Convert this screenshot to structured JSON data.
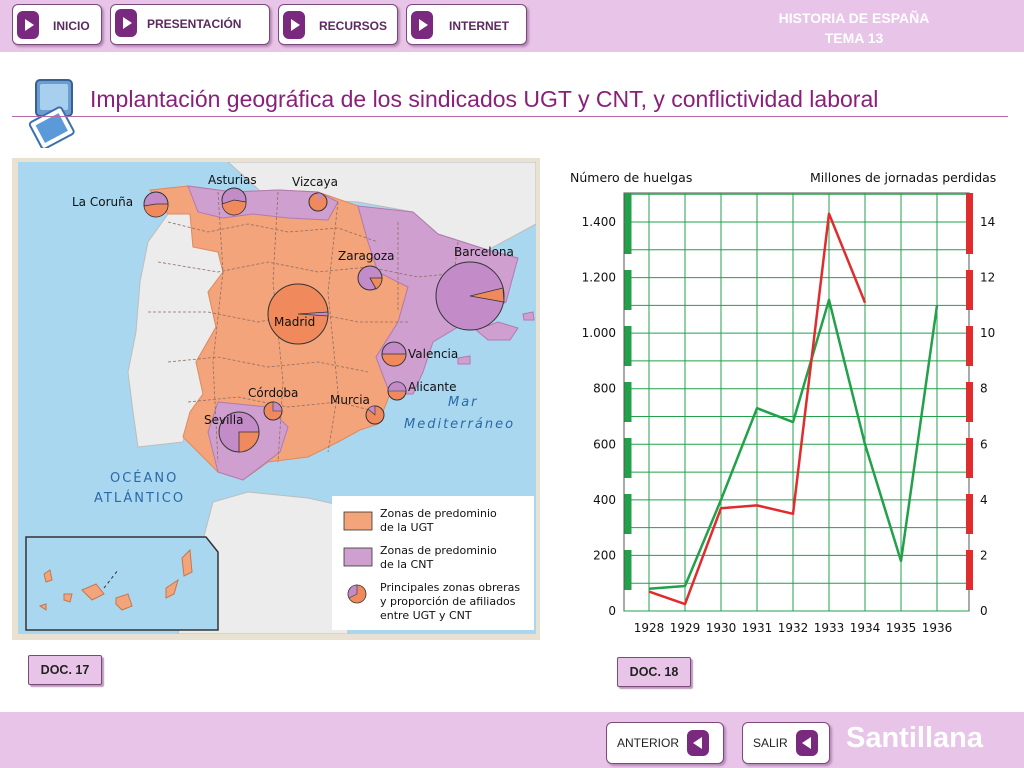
{
  "nav": {
    "items": [
      {
        "label": "INICIO"
      },
      {
        "label": "PRESENTACIÓN"
      },
      {
        "label": "RECURSOS"
      },
      {
        "label": "INTERNET"
      }
    ],
    "corner_line1": "HISTORIA DE ESPAÑA",
    "corner_line2": "TEMA 13"
  },
  "title": "Implantación geográfica de los sindicados UGT y CNT, y conflictividad laboral",
  "map": {
    "place_labels": [
      "La Coruña",
      "Asturias",
      "Vizcaya",
      "Zaragoza",
      "Barcelona",
      "Madrid",
      "Valencia",
      "Alicante",
      "Córdoba",
      "Murcia",
      "Sevilla"
    ],
    "sea_label_1": "Mar",
    "sea_label_2": "Mediterráneo",
    "ocean_label_1": "OCÉANO",
    "ocean_label_2": "ATLÁNTICO",
    "legend": {
      "ugt_line1": "Zonas de predominio",
      "ugt_line2": "de la UGT",
      "cnt_line1": "Zonas de predominio",
      "cnt_line2": "de la CNT",
      "workers_line1": "Principales zonas obreras",
      "workers_line2": "y proporción de afiliados",
      "workers_line3": "entre UGT y CNT"
    },
    "colors": {
      "ugt": "#f4a47a",
      "cnt": "#cfa0cf",
      "cnt_pie": "#c38cc8",
      "ugt_pie": "#f08a5d",
      "sea": "#a9d7ef",
      "land_other": "#ececec"
    }
  },
  "doc17": "DOC. 17",
  "doc18": "DOC. 18",
  "chart_data": {
    "type": "line",
    "x": [
      1928,
      1929,
      1930,
      1931,
      1932,
      1933,
      1934,
      1935,
      1936
    ],
    "left_axis_label": "Número de huelgas",
    "right_axis_label": "Millones de jornadas perdidas",
    "left_ticks": [
      "0",
      "200",
      "400",
      "600",
      "800",
      "1.000",
      "1.200",
      "1.400"
    ],
    "right_ticks": [
      "0",
      "2",
      "4",
      "6",
      "8",
      "10",
      "12",
      "14"
    ],
    "left_ylim": [
      0,
      1400
    ],
    "right_ylim": [
      0,
      14
    ],
    "series": [
      {
        "color": "#23a04a",
        "axis": "left",
        "values": [
          80,
          90,
          400,
          730,
          680,
          1120,
          600,
          180,
          1100
        ]
      },
      {
        "color": "#e02c2c",
        "axis": "right",
        "values": [
          0.7,
          0.25,
          3.7,
          3.8,
          3.5,
          14.3,
          11.1,
          null,
          null
        ]
      }
    ]
  },
  "footer": {
    "prev_label": "ANTERIOR",
    "exit_label": "SALIR",
    "brand": "Santillana"
  }
}
